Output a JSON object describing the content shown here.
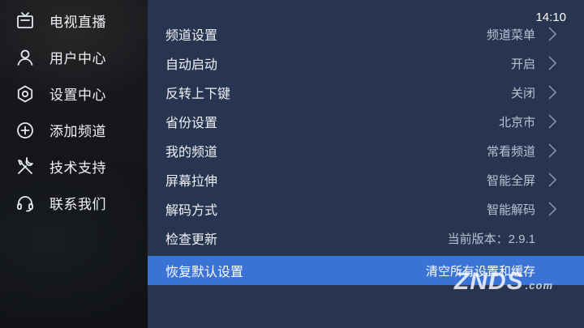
{
  "sidebar": {
    "items": [
      {
        "label": "电视直播",
        "icon": "tv-icon"
      },
      {
        "label": "用户中心",
        "icon": "user-icon"
      },
      {
        "label": "设置中心",
        "icon": "gear-icon"
      },
      {
        "label": "添加频道",
        "icon": "add-circle-icon"
      },
      {
        "label": "技术支持",
        "icon": "tools-icon"
      },
      {
        "label": "联系我们",
        "icon": "headset-icon"
      }
    ],
    "selected": "设置中心"
  },
  "header": {
    "time": "14:10"
  },
  "settings": {
    "rows": [
      {
        "label": "频道设置",
        "value": "频道菜单"
      },
      {
        "label": "自动启动",
        "value": "开启"
      },
      {
        "label": "反转上下键",
        "value": "关闭"
      },
      {
        "label": "省份设置",
        "value": "北京市"
      },
      {
        "label": "我的频道",
        "value": "常看频道"
      },
      {
        "label": "屏幕拉伸",
        "value": "智能全屏"
      },
      {
        "label": "解码方式",
        "value": "智能解码"
      },
      {
        "label": "检查更新",
        "value": "当前版本：2.9.1"
      },
      {
        "label": "恢复默认设置",
        "value": "清空所有设置和缓存"
      }
    ],
    "active_row": "恢复默认设置"
  },
  "watermark": {
    "brand": "ZNDS",
    "suffix": ".com"
  },
  "colors": {
    "panel": "#283551",
    "highlight": "#3a72d6",
    "sidebar": "#121418"
  }
}
